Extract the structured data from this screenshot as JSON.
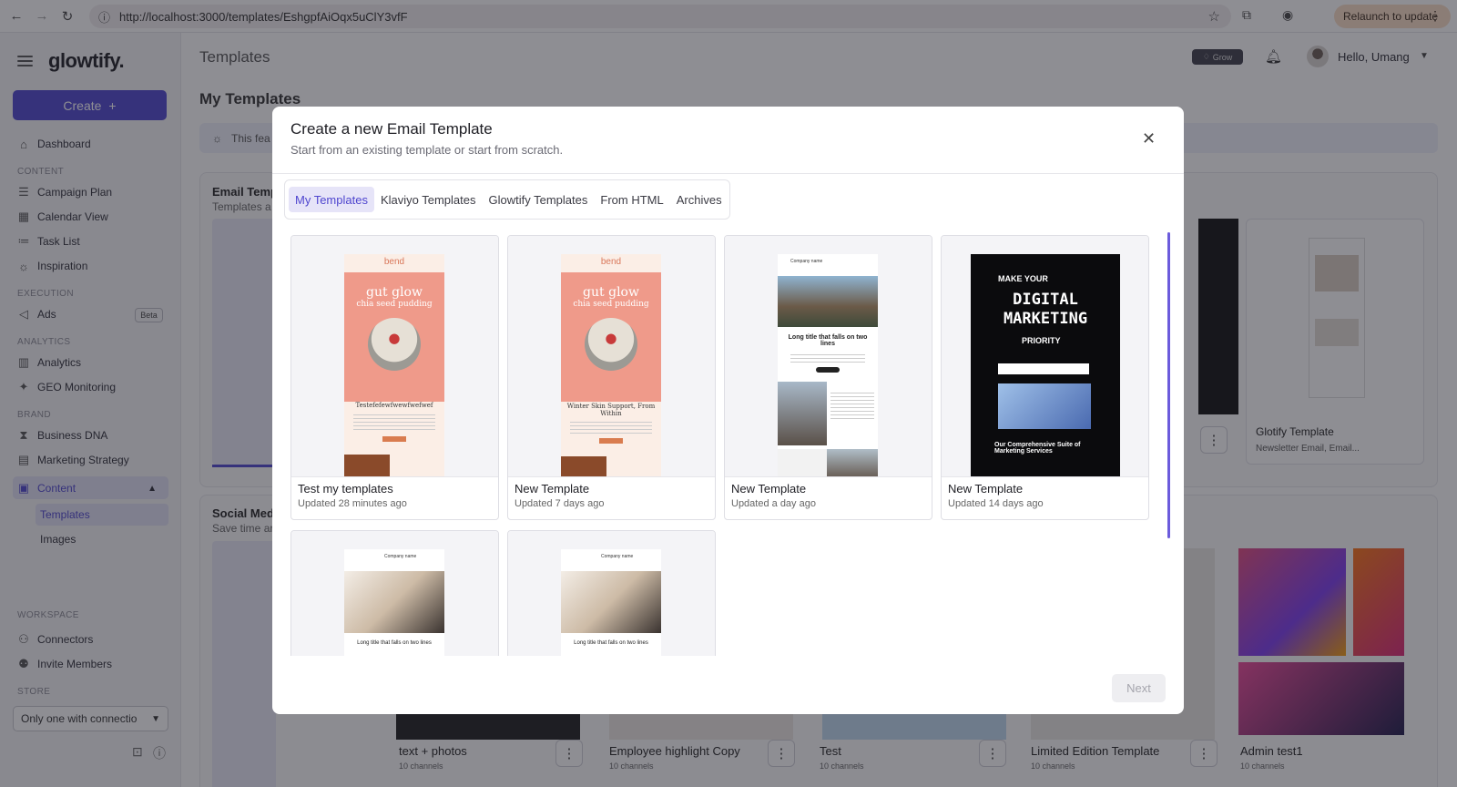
{
  "browser": {
    "url": "http://localhost:3000/templates/EshgpfAiOqx5uClY3vfF",
    "relaunch_label": "Relaunch to update"
  },
  "sidebar": {
    "logo": "glowtify.",
    "create_label": "Create",
    "items": {
      "dashboard": "Dashboard",
      "content_section": "CONTENT",
      "campaign_plan": "Campaign Plan",
      "calendar_view": "Calendar View",
      "task_list": "Task List",
      "inspiration": "Inspiration",
      "execution_section": "EXECUTION",
      "ads": "Ads",
      "ads_badge": "Beta",
      "analytics_section": "ANALYTICS",
      "analytics": "Analytics",
      "geo_monitoring": "GEO Monitoring",
      "brand_section": "BRAND",
      "business_dna": "Business DNA",
      "marketing_strategy": "Marketing Strategy",
      "content": "Content",
      "templates": "Templates",
      "images": "Images",
      "workspace_section": "WORKSPACE",
      "connectors": "Connectors",
      "invite_members": "Invite Members",
      "store_section": "STORE"
    },
    "store_value": "Only one with connectio"
  },
  "header": {
    "page_title": "Templates",
    "grow_label": "Grow",
    "greeting": "Hello, Umang"
  },
  "main": {
    "section_title": "My Templates",
    "info_text": "This fea",
    "email_heading": "Email Temp",
    "email_sub": "Templates a",
    "social_heading": "Social Med",
    "social_sub": "Save time ar",
    "bg_right_card_name": "Glotify Template",
    "bg_right_card_sub": "Newsletter Email, Email...",
    "bg_bottom_cards": [
      {
        "name": "text + photos",
        "sub": "10 channels"
      },
      {
        "name": "Employee highlight Copy",
        "sub": "10 channels"
      },
      {
        "name": "Test",
        "sub": "10 channels"
      },
      {
        "name": "Limited Edition Template",
        "sub": "10 channels"
      },
      {
        "name": "Admin test1",
        "sub": "10 channels"
      }
    ]
  },
  "modal": {
    "title": "Create a new Email Template",
    "subtitle": "Start from an existing template or start from scratch.",
    "tabs": [
      "My Templates",
      "Klaviyo Templates",
      "Glowtify Templates",
      "From HTML",
      "Archives"
    ],
    "active_tab": "My Templates",
    "templates": [
      {
        "name": "Test my templates",
        "updated": "Updated 28 minutes ago",
        "brand": "bend",
        "headline": "gut glow",
        "subline": "chia seed pudding",
        "body_title": "Testefefewfwewfwefwef"
      },
      {
        "name": "New Template",
        "updated": "Updated 7 days ago",
        "brand": "bend",
        "headline": "gut glow",
        "subline": "chia seed pudding",
        "body_title": "Winter Skin Support, From Within"
      },
      {
        "name": "New Template",
        "updated": "Updated a day ago",
        "brand": "Company name",
        "headline": "Long title that falls on two lines"
      },
      {
        "name": "New Template",
        "updated": "Updated 14 days ago",
        "brand": "MAKE YOUR",
        "headline": "DIGITAL MARKETING",
        "subline": "PRIORITY",
        "body_title": "Our Comprehensive Suite of Marketing Services"
      },
      {
        "name": "",
        "updated": "",
        "brand": "Company name",
        "headline": "Long title that falls on two lines"
      },
      {
        "name": "",
        "updated": "",
        "brand": "Company name",
        "headline": "Long title that falls on two lines"
      }
    ],
    "next_label": "Next"
  }
}
